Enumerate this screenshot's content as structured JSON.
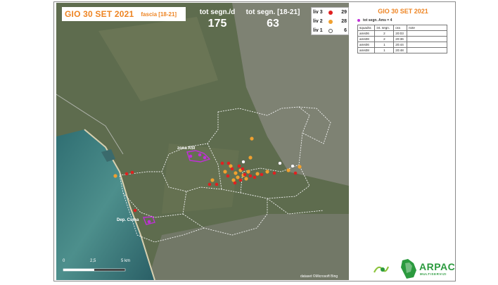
{
  "header": {
    "date": "GIO 30 SET 2021",
    "fascia": "fascia [18-21]"
  },
  "stats": {
    "tot_day_label": "tot segn./d",
    "tot_day_value": "175",
    "tot_band_label": "tot segn. [18-21]",
    "tot_band_value": "63"
  },
  "legend": [
    {
      "name": "liv 3",
      "color": "#e02020",
      "count": "29"
    },
    {
      "name": "liv 2",
      "color": "#f0a030",
      "count": "28"
    },
    {
      "name": "liv 1",
      "color": "#ffffff",
      "count": "6"
    }
  ],
  "map_labels": {
    "zona_asi": "zona ASI",
    "dep_cuma": "Dep. Cuma",
    "scale_0": "0",
    "scale_mid": "2,5",
    "scale_end": "5 km",
    "attribution": "dataset ©Microsoft Bing"
  },
  "side": {
    "title": "GIO 30 SET 2021",
    "subtitle": "tot segn. Ams = 4",
    "columns": [
      "squadra",
      "int. segn.",
      "ora",
      "note"
    ],
    "rows": [
      {
        "squadra": "ams06",
        "int": "2",
        "ora": "20:03",
        "note": ""
      },
      {
        "squadra": "ams08",
        "int": "2",
        "ora": "20:36",
        "note": ""
      },
      {
        "squadra": "ams06",
        "int": "1",
        "ora": "20:44",
        "note": ""
      },
      {
        "squadra": "ams08",
        "int": "1",
        "ora": "20:48",
        "note": ""
      }
    ]
  },
  "logo": {
    "name": "ARPAC",
    "sub": "MULTISERVIZI",
    "brand_color": "#2b9a3e"
  },
  "colors": {
    "accent": "#ee8422",
    "ams": "#c030d8"
  }
}
